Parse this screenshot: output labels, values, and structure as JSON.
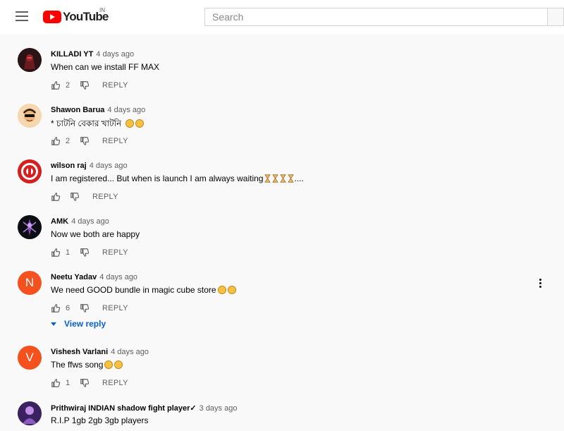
{
  "header": {
    "logo_text": "YouTube",
    "country_code": "IN",
    "search_placeholder": "Search"
  },
  "comments": [
    {
      "author": "KILLADI YT",
      "time": "4 days ago",
      "text": "When can we install FF MAX",
      "likes": "2",
      "reply_label": "REPLY",
      "avatar_color": "#1a1a1a"
    },
    {
      "author": "Shawon Barua",
      "time": "4 days ago",
      "text": "* চাটনি বেকার খাটনি",
      "likes": "2",
      "reply_label": "REPLY",
      "avatar_color": "#f0b36b"
    },
    {
      "author": "wilson raj",
      "time": "4 days ago",
      "text": "I am registered... But when is launch I am always waiting",
      "text_suffix": "....",
      "likes": "",
      "reply_label": "REPLY",
      "avatar_color": "#d62020"
    },
    {
      "author": "AMK",
      "time": "4 days ago",
      "text": "Now we both are happy",
      "likes": "1",
      "reply_label": "REPLY",
      "avatar_color": "#111111"
    },
    {
      "author": "Neetu Yadav",
      "time": "4 days ago",
      "text": "We need GOOD bundle in magic cube store",
      "likes": "6",
      "reply_label": "REPLY",
      "avatar_letter": "N",
      "avatar_color": "#f4511e"
    },
    {
      "author": "Vishesh Varlani",
      "time": "4 days ago",
      "text": "The ffws song",
      "likes": "1",
      "reply_label": "REPLY",
      "avatar_letter": "V",
      "avatar_color": "#f4511e"
    },
    {
      "author": "Prithwiraj INDIAN shadow fight player✓",
      "time": "3 days ago",
      "text": "R.I.P 1gb 2gb 3gb players",
      "avatar_color": "#4a2a7a"
    }
  ],
  "view_reply_label": "View reply",
  "colors": {
    "link": "#065fd4",
    "brand": "#ff0000",
    "letter_avatar": "#f4511e"
  }
}
